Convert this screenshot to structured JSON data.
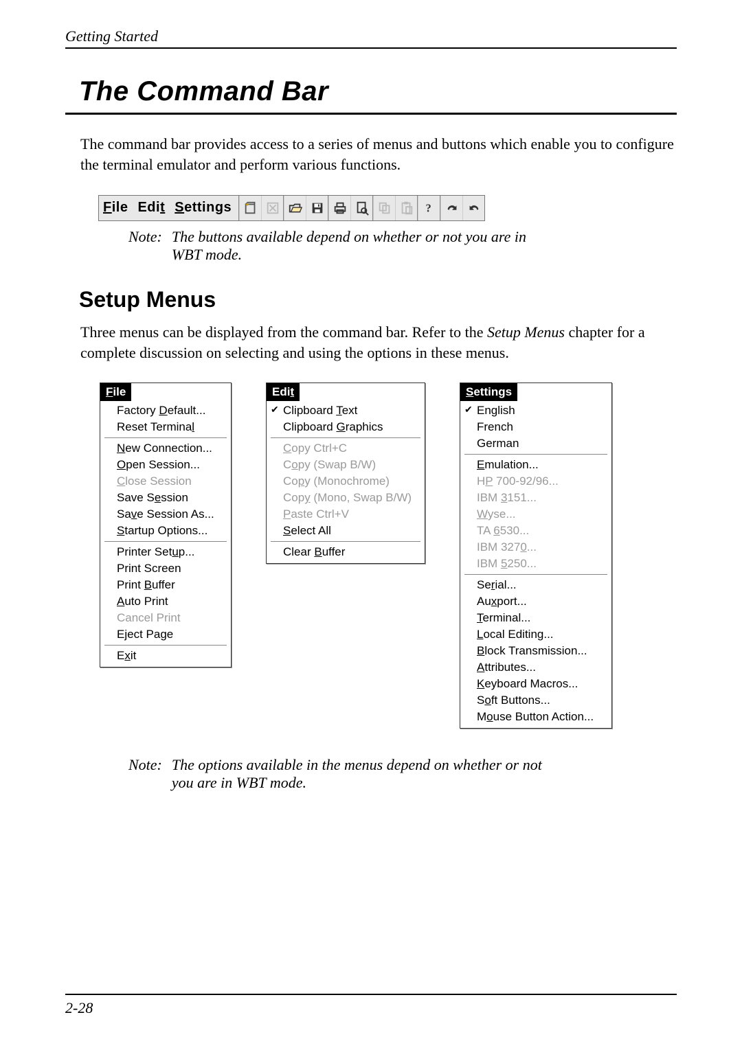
{
  "running_head": "Getting Started",
  "title": "The Command Bar",
  "intro": "The command bar provides access to a series of menus and buttons which enable you to configure the terminal emulator and perform various functions.",
  "command_bar": {
    "menus": [
      {
        "u": "F",
        "rest": "ile"
      },
      {
        "u": "",
        "rest": "Edi",
        "tail_u": "t"
      },
      {
        "u": "S",
        "rest": "ettings"
      }
    ],
    "icons": [
      "new-session-icon",
      "close-session-icon",
      "open-icon",
      "save-icon",
      "print-icon",
      "print-preview-icon",
      "copy-icon",
      "paste-icon",
      "help-icon",
      "redo-icon",
      "undo-icon"
    ]
  },
  "note1_label": "Note:",
  "note1_text": "The buttons available depend on whether or not you are in WBT mode.",
  "subtitle": "Setup Menus",
  "para2_a": "Three menus can be displayed from the command bar. Refer to the ",
  "para2_em": "Setup Menus",
  "para2_b": " chapter for a complete discussion on selecting and using the options in these menus.",
  "menus": {
    "file": {
      "title_u": "F",
      "title_rest": "ile",
      "groups": [
        [
          {
            "pre": "Factory ",
            "u": "D",
            "post": "efault...",
            "disabled": false
          },
          {
            "pre": "Reset Termina",
            "u": "l",
            "post": "",
            "disabled": false
          }
        ],
        [
          {
            "pre": "",
            "u": "N",
            "post": "ew Connection...",
            "disabled": false
          },
          {
            "pre": "",
            "u": "O",
            "post": "pen Session...",
            "disabled": false
          },
          {
            "pre": "",
            "u": "C",
            "post": "lose Session",
            "disabled": true
          },
          {
            "pre": "Save S",
            "u": "e",
            "post": "ssion",
            "disabled": false
          },
          {
            "pre": "Sa",
            "u": "v",
            "post": "e Session As...",
            "disabled": false
          },
          {
            "pre": "",
            "u": "S",
            "post": "tartup Options...",
            "disabled": false
          }
        ],
        [
          {
            "pre": "Printer Set",
            "u": "u",
            "post": "p...",
            "disabled": false
          },
          {
            "pre": "Print Screen",
            "u": "",
            "post": "",
            "disabled": false
          },
          {
            "pre": "Print ",
            "u": "B",
            "post": "uffer",
            "disabled": false
          },
          {
            "pre": "",
            "u": "A",
            "post": "uto Print",
            "disabled": false
          },
          {
            "pre": "Cancel Print",
            "u": "",
            "post": "",
            "disabled": true
          },
          {
            "pre": "E",
            "u": "j",
            "post": "ect Page",
            "disabled": false
          }
        ],
        [
          {
            "pre": "E",
            "u": "x",
            "post": "it",
            "disabled": false
          }
        ]
      ]
    },
    "edit": {
      "title_pre": "Edi",
      "title_u": "t",
      "groups": [
        [
          {
            "pre": "Clipboard ",
            "u": "T",
            "post": "ext",
            "disabled": false,
            "checked": true
          },
          {
            "pre": "Clipboard ",
            "u": "G",
            "post": "raphics",
            "disabled": false
          }
        ],
        [
          {
            "pre": "",
            "u": "C",
            "post": "opy  Ctrl+C",
            "disabled": true
          },
          {
            "pre": "C",
            "u": "o",
            "post": "py  (Swap B/W)",
            "disabled": true
          },
          {
            "pre": "Co",
            "u": "p",
            "post": "y  (Monochrome)",
            "disabled": true
          },
          {
            "pre": "Cop",
            "u": "y",
            "post": "  (Mono, Swap B/W)",
            "disabled": true
          },
          {
            "pre": "",
            "u": "P",
            "post": "aste  Ctrl+V",
            "disabled": true
          },
          {
            "pre": "",
            "u": "S",
            "post": "elect All",
            "disabled": false
          }
        ],
        [
          {
            "pre": "Clear ",
            "u": "B",
            "post": "uffer",
            "disabled": false
          }
        ]
      ]
    },
    "settings": {
      "title_u": "S",
      "title_rest": "ettings",
      "groups": [
        [
          {
            "pre": "English",
            "u": "",
            "post": "",
            "disabled": false,
            "checked": true
          },
          {
            "pre": "French",
            "u": "",
            "post": "",
            "disabled": false
          },
          {
            "pre": "German",
            "u": "",
            "post": "",
            "disabled": false
          }
        ],
        [
          {
            "pre": "",
            "u": "E",
            "post": "mulation...",
            "disabled": false
          },
          {
            "pre": "H",
            "u": "P",
            "post": " 700-92/96...",
            "disabled": true
          },
          {
            "pre": "IBM ",
            "u": "3",
            "post": "151...",
            "disabled": true
          },
          {
            "pre": "",
            "u": "W",
            "post": "yse...",
            "disabled": true
          },
          {
            "pre": "TA ",
            "u": "6",
            "post": "530...",
            "disabled": true
          },
          {
            "pre": "IBM 327",
            "u": "0",
            "post": "...",
            "disabled": true
          },
          {
            "pre": "IBM ",
            "u": "5",
            "post": "250...",
            "disabled": true
          }
        ],
        [
          {
            "pre": "Se",
            "u": "r",
            "post": "ial...",
            "disabled": false
          },
          {
            "pre": "Au",
            "u": "x",
            "post": "port...",
            "disabled": false
          },
          {
            "pre": "",
            "u": "T",
            "post": "erminal...",
            "disabled": false
          },
          {
            "pre": "",
            "u": "L",
            "post": "ocal Editing...",
            "disabled": false
          },
          {
            "pre": "",
            "u": "B",
            "post": "lock Transmission...",
            "disabled": false
          },
          {
            "pre": "",
            "u": "A",
            "post": "ttributes...",
            "disabled": false
          },
          {
            "pre": "",
            "u": "K",
            "post": "eyboard Macros...",
            "disabled": false
          },
          {
            "pre": "S",
            "u": "o",
            "post": "ft Buttons...",
            "disabled": false
          },
          {
            "pre": "M",
            "u": "o",
            "post": "use Button Action...",
            "disabled": false
          }
        ]
      ]
    }
  },
  "note2_label": "Note:",
  "note2_text": "The options available in the menus depend on whether or not you are in WBT mode.",
  "page_number": "2-28"
}
